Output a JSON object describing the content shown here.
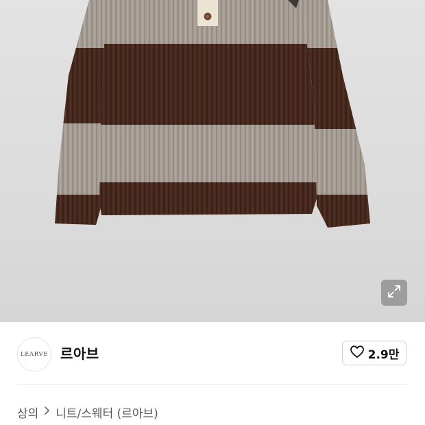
{
  "product_image": {
    "expand_icon": "expand-arrows-icon",
    "colors": {
      "beige_knit": "#a69d94",
      "brown_stripe": "#46291f",
      "background": "#dddddd",
      "button": "#6e4a33"
    }
  },
  "shop": {
    "logo_text": "LEARVE",
    "name": "르아브",
    "like_icon": "heart-outline-icon",
    "like_count": "2.9만"
  },
  "breadcrumb": {
    "items": [
      "상의",
      "니트/스웨터 (르아브)"
    ],
    "separator_icon": "chevron-right-icon"
  }
}
